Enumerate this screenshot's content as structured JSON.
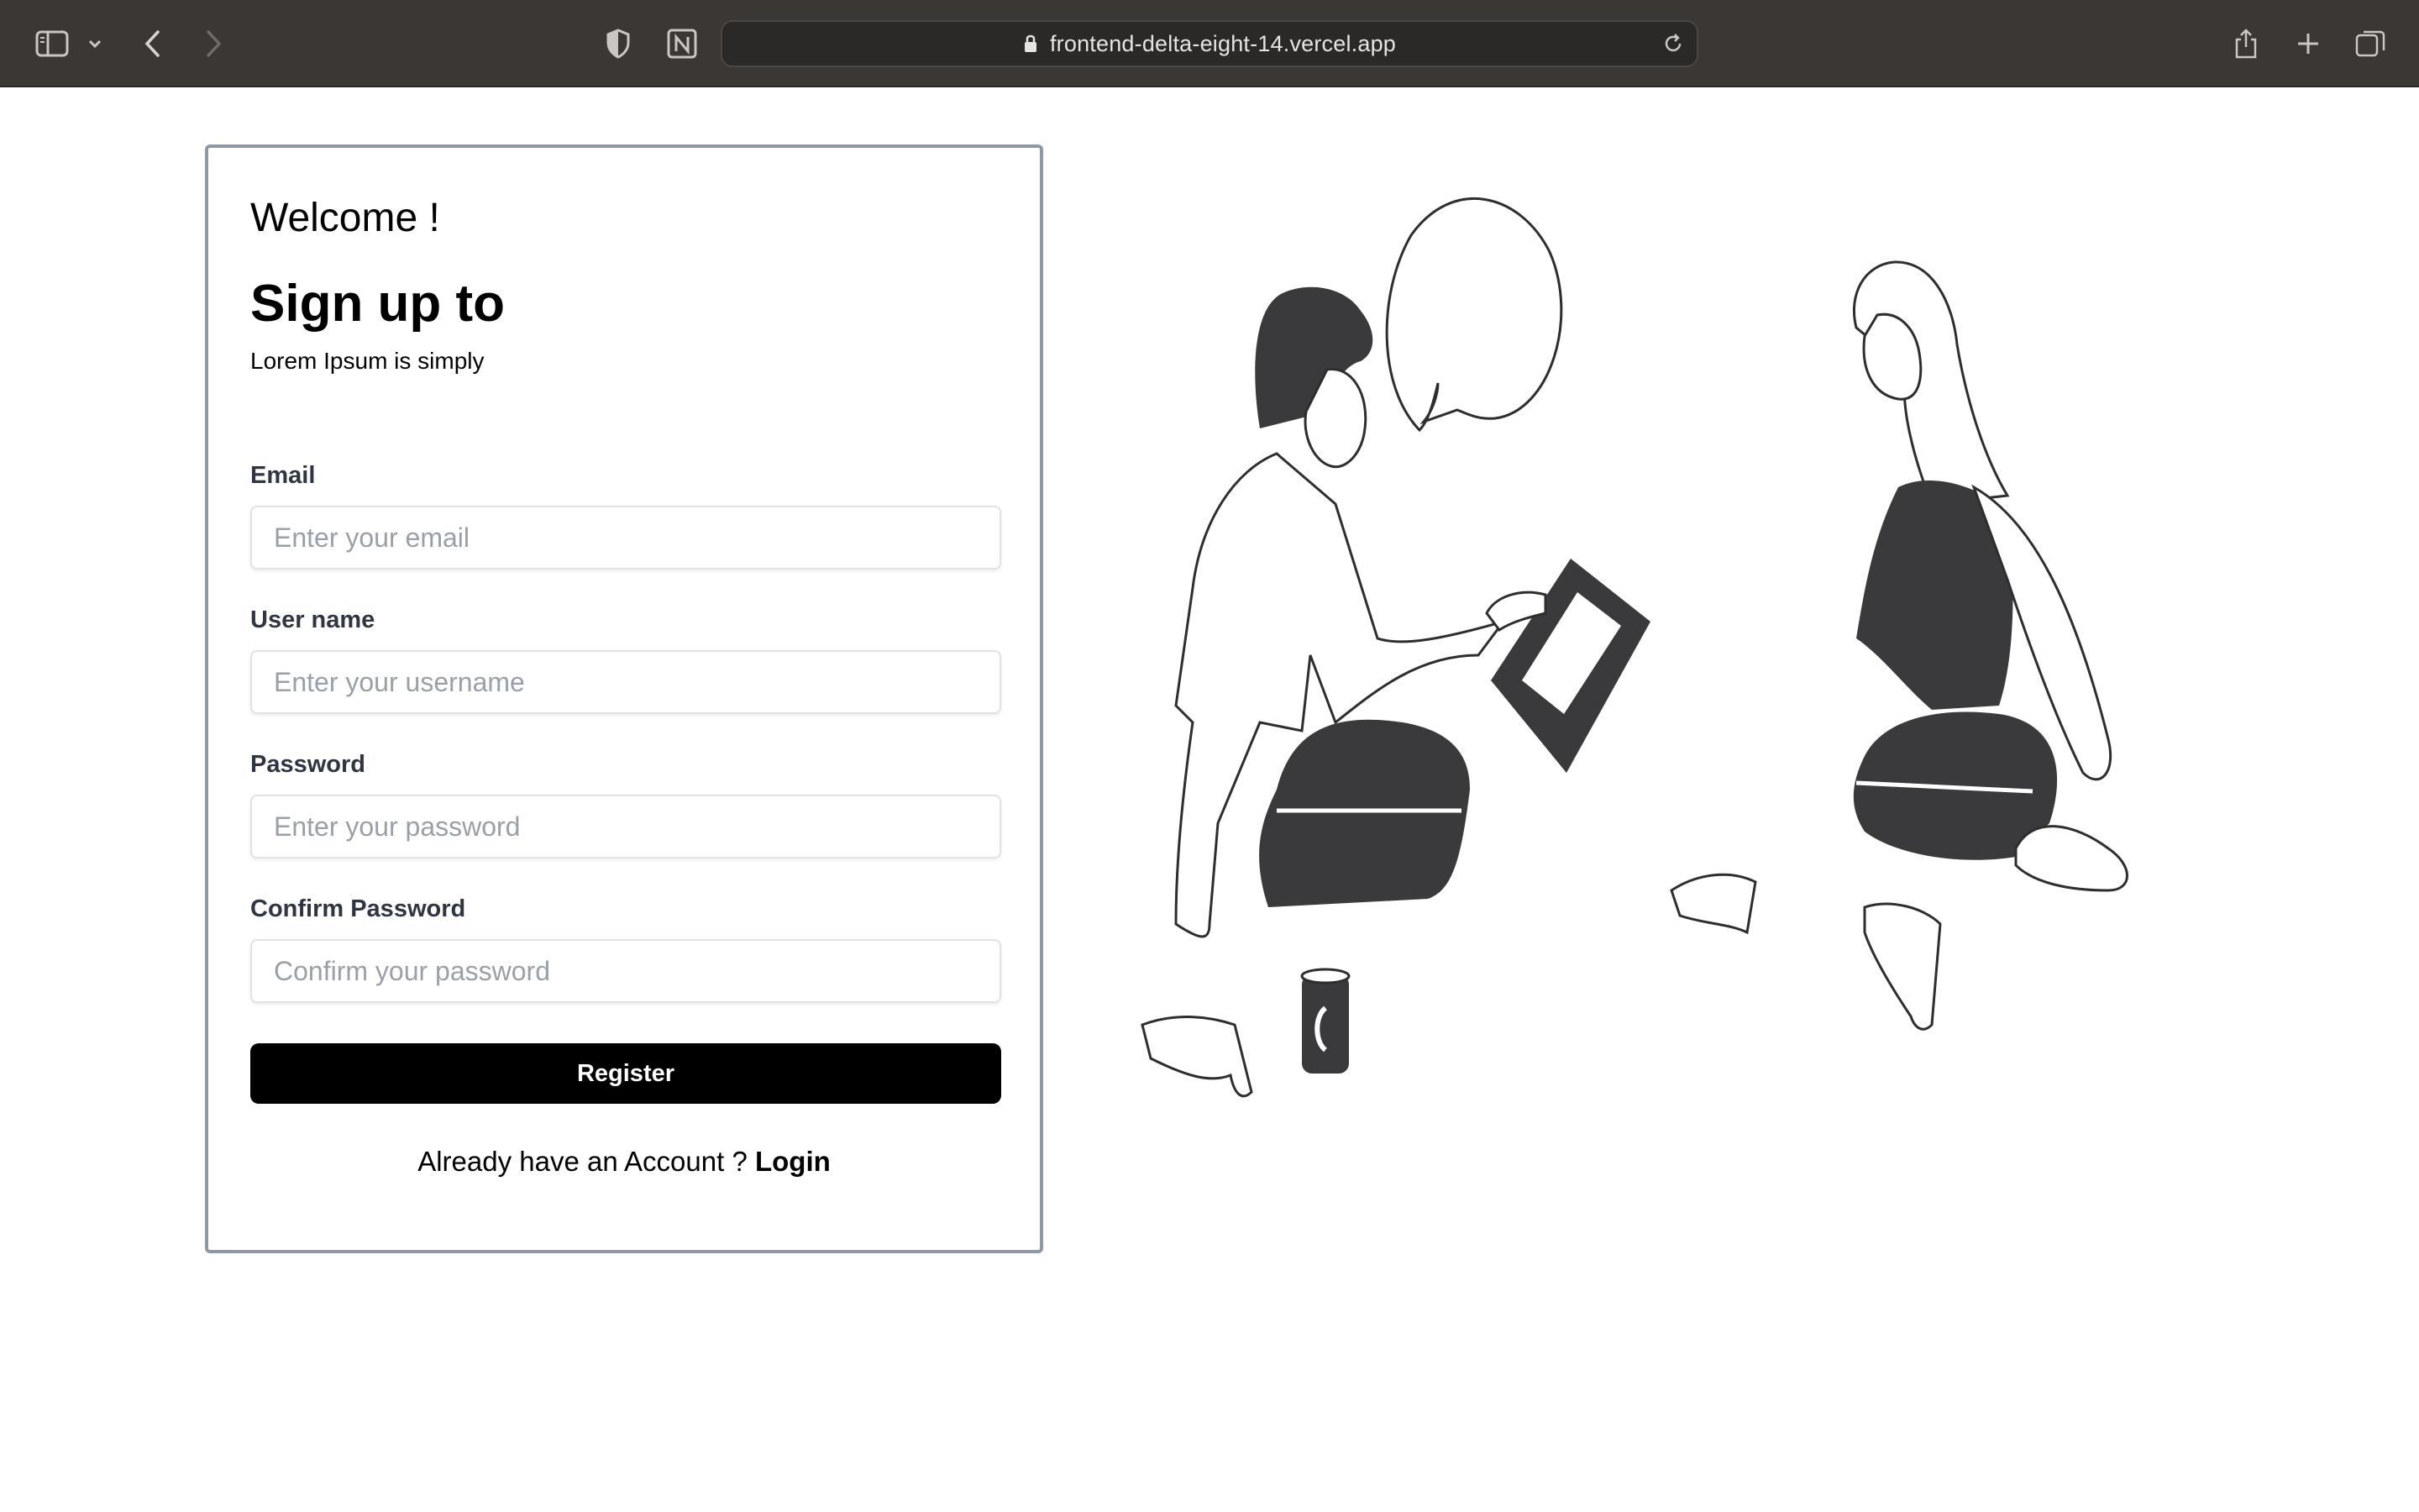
{
  "browser": {
    "url": "frontend-delta-eight-14.vercel.app",
    "icons": [
      "sidebar-icon",
      "chevron-down-icon",
      "back-icon",
      "forward-icon",
      "shield-icon",
      "notion-icon",
      "lock-icon",
      "reload-icon",
      "share-icon",
      "new-tab-icon",
      "tab-overview-icon"
    ]
  },
  "form": {
    "welcome": "Welcome !",
    "title": "Sign up to",
    "subtitle": "Lorem Ipsum is simply",
    "fields": [
      {
        "label": "Email",
        "placeholder": "Enter your email",
        "value": ""
      },
      {
        "label": "User name",
        "placeholder": "Enter your username",
        "value": ""
      },
      {
        "label": "Password",
        "placeholder": "Enter your password",
        "value": ""
      },
      {
        "label": "Confirm Password",
        "placeholder": "Confirm your password",
        "value": ""
      }
    ],
    "register_label": "Register",
    "login_prompt": "Already have an Account ?",
    "login_label": "Login"
  },
  "colors": {
    "toolbar_bg": "#3a3735",
    "card_border": "#8f98a6",
    "button_bg": "#000000",
    "illustration_fill": "#3a3a3c"
  }
}
